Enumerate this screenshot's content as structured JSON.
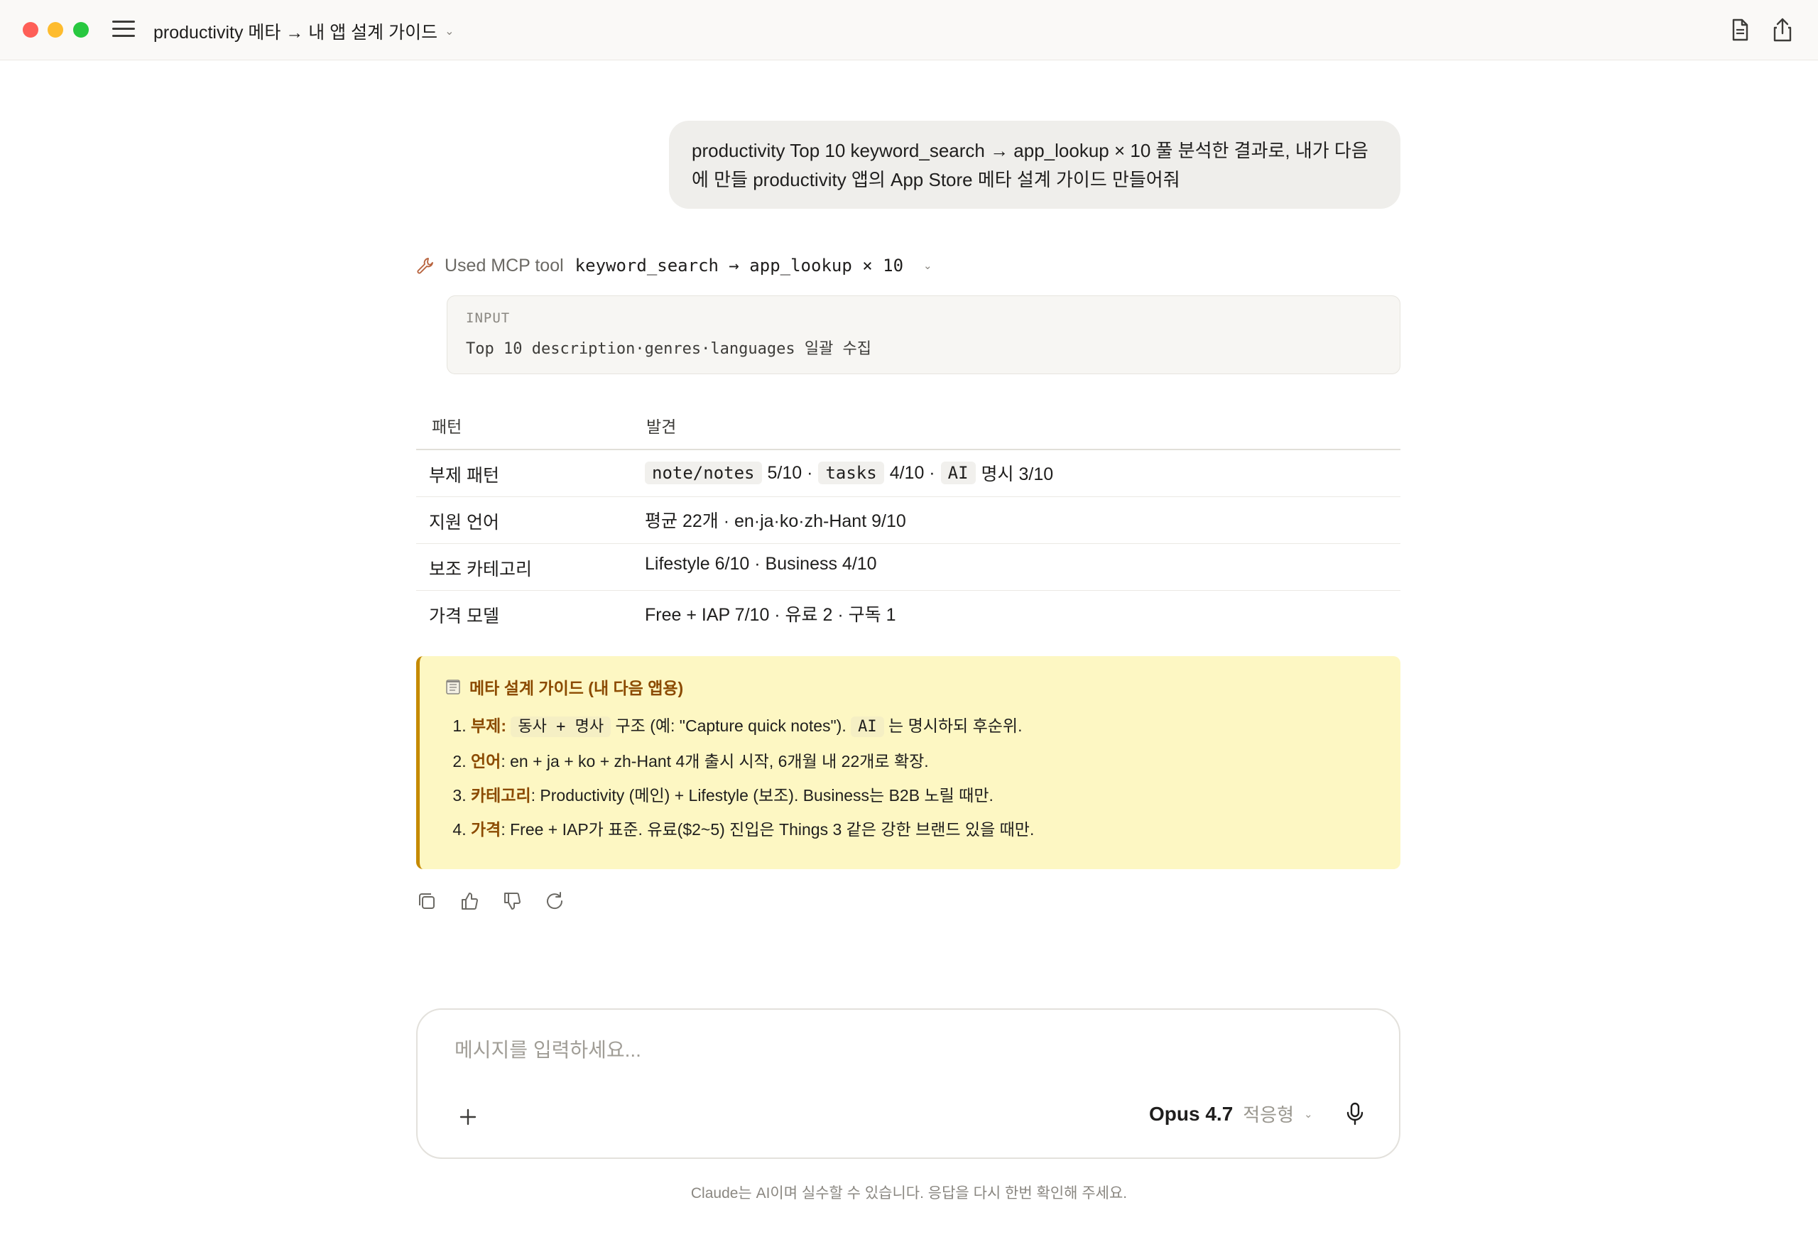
{
  "window": {
    "title": "productivity 메타 → 내 앱 설계 가이드",
    "title_chevron": "⌄",
    "icons": [
      "menu-icon",
      "document-icon",
      "share-icon"
    ]
  },
  "conversation": {
    "user_message": "productivity Top 10 keyword_search → app_lookup × 10 풀 분석한 결과로, 내가 다음에 만들 productivity 앱의 App Store 메타 설계 가이드 만들어줘",
    "tool_use": {
      "label": "Used MCP tool",
      "call": "keyword_search → app_lookup × 10",
      "chevron": "⌄",
      "input_caption": "INPUT",
      "input_text": "Top 10 description·genres·languages 일괄 수집"
    },
    "table": {
      "headers": [
        "패턴",
        "발견"
      ],
      "rows": [
        {
          "pattern": "부제 패턴",
          "parts": [
            {
              "code": "note/notes",
              "text": "5/10 ·"
            },
            {
              "code": "tasks",
              "text": "4/10 ·"
            },
            {
              "code": "AI",
              "text": "명시 3/10"
            }
          ]
        },
        {
          "pattern": "지원 언어",
          "finding": "평균 22개 · en·ja·ko·zh-Hant 9/10"
        },
        {
          "pattern": "보조 카테고리",
          "finding": "Lifestyle 6/10 · Business 4/10"
        },
        {
          "pattern": "가격 모델",
          "finding": "Free + IAP 7/10 · 유료 2 · 구독 1"
        }
      ]
    },
    "callout": {
      "heading": "메타 설계 가이드 (내 다음 앱용)",
      "icon": "notepad-icon",
      "items": [
        {
          "label": "부제",
          "code": "동사 + 명사",
          "text": "구조 (예: \"Capture quick notes\").",
          "code2": "AI",
          "text2": "는 명시하되 후순위."
        },
        {
          "label": "언어",
          "text": ": en + ja + ko + zh-Hant 4개 출시 시작, 6개월 내 22개로 확장."
        },
        {
          "label": "카테고리",
          "text": ": Productivity (메인) + Lifestyle (보조). Business는 B2B 노릴 때만."
        },
        {
          "label": "가격",
          "text": ": Free + IAP가 표준. 유료($2~5) 진입은 Things 3 같은 강한 브랜드 있을 때만."
        }
      ],
      "colors": {
        "background": "#fdf7c3",
        "accent": "#c58a00",
        "label": "#8b4a00"
      }
    },
    "actions": [
      "copy-icon",
      "thumbs-up-icon",
      "thumbs-down-icon",
      "retry-icon"
    ]
  },
  "composer": {
    "placeholder": "메시지를 입력하세요...",
    "value": "",
    "model_name": "Opus 4.7",
    "mode": "적응형",
    "chevron": "⌄"
  },
  "footer": {
    "disclaimer": "Claude는 AI이며 실수할 수 있습니다. 응답을 다시 한번 확인해 주세요."
  }
}
